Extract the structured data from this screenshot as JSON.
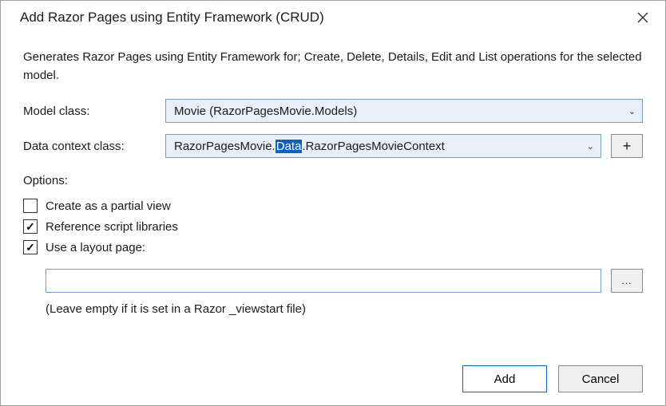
{
  "dialog": {
    "title": "Add Razor Pages using Entity Framework (CRUD)",
    "description": "Generates Razor Pages using Entity Framework for; Create, Delete, Details, Edit and List operations for the selected model."
  },
  "fields": {
    "model_class": {
      "label": "Model class:",
      "value": "Movie (RazorPagesMovie.Models)"
    },
    "data_context_class": {
      "label": "Data context class:",
      "value_prefix": "RazorPagesMovie.",
      "value_highlighted": "Data",
      "value_postfix_dot": ".",
      "value_suffix": "RazorPagesMovieContext",
      "add_button": "+"
    }
  },
  "options": {
    "label": "Options:",
    "partial_view": {
      "label": "Create as a partial view",
      "checked": false
    },
    "reference_scripts": {
      "label": "Reference script libraries",
      "checked": true
    },
    "use_layout": {
      "label": "Use a layout page:",
      "checked": true
    },
    "layout_path_value": "",
    "browse_label": "...",
    "hint": "(Leave empty if it is set in a Razor _viewstart file)"
  },
  "buttons": {
    "add": "Add",
    "cancel": "Cancel"
  }
}
